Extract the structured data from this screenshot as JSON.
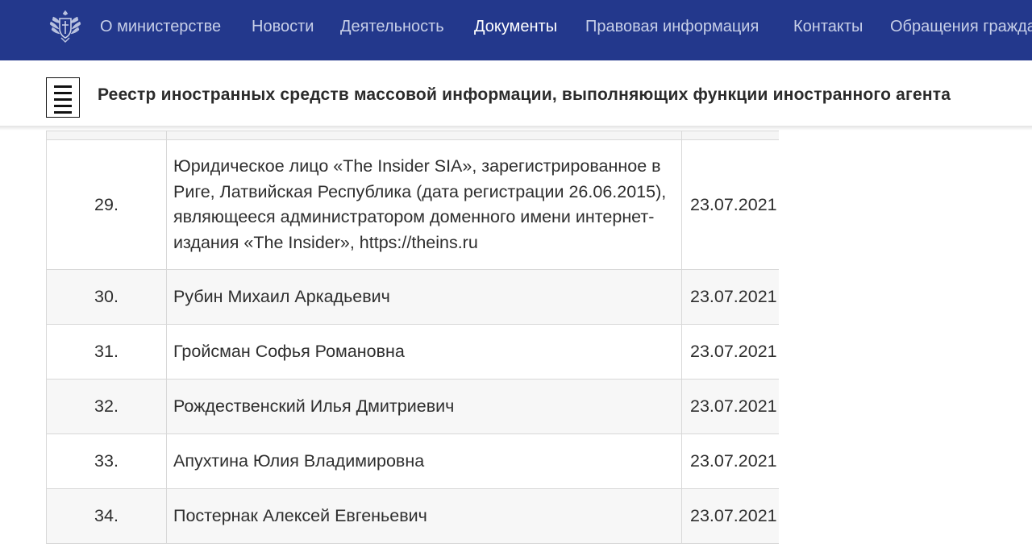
{
  "nav": {
    "items": [
      {
        "label": "О министерстве",
        "active": false
      },
      {
        "label": "Новости",
        "active": false
      },
      {
        "label": "Деятельность",
        "active": false
      },
      {
        "label": "Документы",
        "active": true
      },
      {
        "label": "Правовая информация",
        "active": false
      },
      {
        "label": "Контакты",
        "active": false
      },
      {
        "label": "Обращения граждан",
        "active": false
      }
    ]
  },
  "page": {
    "title": "Реестр иностранных средств массовой информации, выполняющих функции иностранного агента"
  },
  "registry": {
    "rows": [
      {
        "num": "29.",
        "name": "Юридическое лицо «The Insider SIA», зарегистрированное в Риге, Латвийская Республика (дата регистрации 26.06.2015), являющееся администратором доменного имени интернет-издания «The Insider», https://theins.ru",
        "date": "23.07.2021"
      },
      {
        "num": "30.",
        "name": "Рубин Михаил Аркадьевич",
        "date": "23.07.2021"
      },
      {
        "num": "31.",
        "name": "Гройсман Софья Романовна",
        "date": "23.07.2021"
      },
      {
        "num": "32.",
        "name": "Рождественский Илья Дмитриевич",
        "date": "23.07.2021"
      },
      {
        "num": "33.",
        "name": "Апухтина Юлия Владимировна",
        "date": "23.07.2021"
      },
      {
        "num": "34.",
        "name": "Постернак Алексей Евгеньевич",
        "date": "23.07.2021"
      }
    ]
  },
  "colors": {
    "nav_background": "#23388c",
    "nav_text": "#c7cfe8",
    "nav_active_text": "#ffffff",
    "row_alt_background": "#f7f7f7",
    "table_border": "#d8d8d8"
  },
  "icons": {
    "emblem": "ministry-emblem-icon",
    "document": "document-icon"
  }
}
